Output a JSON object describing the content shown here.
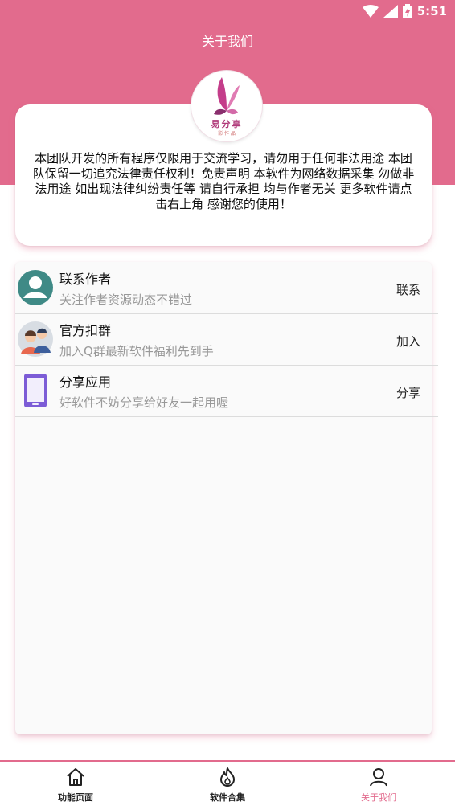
{
  "status_bar": {
    "time": "5:51"
  },
  "header": {
    "title": "关于我们",
    "accent_color": "#e26b8d"
  },
  "logo": {
    "text": "易分享",
    "subtext": "影 作 品"
  },
  "disclaimer": {
    "text": "本团队开发的所有程序仅限用于交流学习，请勿用于任何非法用途 本团队保留一切追究法律责任权利！免责声明 本软件为网络数据采集 勿做非法用途 如出现法律纠纷责任等 请自行承担 均与作者无关 更多软件请点击右上角 感谢您的使用！"
  },
  "list": {
    "items": [
      {
        "title": "联系作者",
        "subtitle": "关注作者资源动态不错过",
        "action": "联系",
        "icon": "person-avatar-icon"
      },
      {
        "title": "官方扣群",
        "subtitle": "加入Q群最新软件福利先到手",
        "action": "加入",
        "icon": "group-icon"
      },
      {
        "title": "分享应用",
        "subtitle": "好软件不妨分享给好友一起用喔",
        "action": "分享",
        "icon": "phone-icon"
      }
    ]
  },
  "bottom_nav": {
    "items": [
      {
        "label": "功能页面",
        "icon": "home-icon"
      },
      {
        "label": "软件合集",
        "icon": "flame-icon"
      },
      {
        "label": "关于我们",
        "icon": "user-icon",
        "active": true
      }
    ]
  }
}
